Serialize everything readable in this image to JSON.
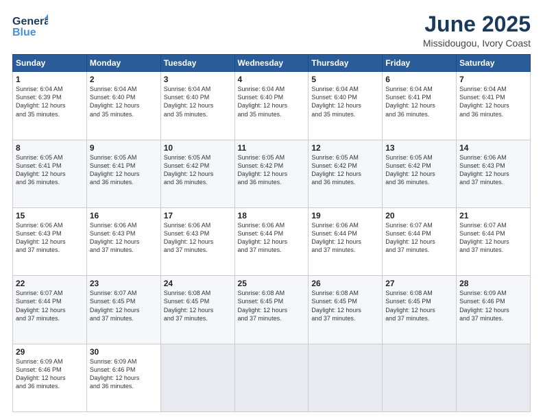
{
  "header": {
    "logo_line1": "General",
    "logo_line2": "Blue",
    "title": "June 2025",
    "subtitle": "Missidougou, Ivory Coast"
  },
  "calendar": {
    "days_of_week": [
      "Sunday",
      "Monday",
      "Tuesday",
      "Wednesday",
      "Thursday",
      "Friday",
      "Saturday"
    ],
    "weeks": [
      [
        {
          "day": "1",
          "info": "Sunrise: 6:04 AM\nSunset: 6:39 PM\nDaylight: 12 hours\nand 35 minutes."
        },
        {
          "day": "2",
          "info": "Sunrise: 6:04 AM\nSunset: 6:40 PM\nDaylight: 12 hours\nand 35 minutes."
        },
        {
          "day": "3",
          "info": "Sunrise: 6:04 AM\nSunset: 6:40 PM\nDaylight: 12 hours\nand 35 minutes."
        },
        {
          "day": "4",
          "info": "Sunrise: 6:04 AM\nSunset: 6:40 PM\nDaylight: 12 hours\nand 35 minutes."
        },
        {
          "day": "5",
          "info": "Sunrise: 6:04 AM\nSunset: 6:40 PM\nDaylight: 12 hours\nand 35 minutes."
        },
        {
          "day": "6",
          "info": "Sunrise: 6:04 AM\nSunset: 6:41 PM\nDaylight: 12 hours\nand 36 minutes."
        },
        {
          "day": "7",
          "info": "Sunrise: 6:04 AM\nSunset: 6:41 PM\nDaylight: 12 hours\nand 36 minutes."
        }
      ],
      [
        {
          "day": "8",
          "info": "Sunrise: 6:05 AM\nSunset: 6:41 PM\nDaylight: 12 hours\nand 36 minutes."
        },
        {
          "day": "9",
          "info": "Sunrise: 6:05 AM\nSunset: 6:41 PM\nDaylight: 12 hours\nand 36 minutes."
        },
        {
          "day": "10",
          "info": "Sunrise: 6:05 AM\nSunset: 6:42 PM\nDaylight: 12 hours\nand 36 minutes."
        },
        {
          "day": "11",
          "info": "Sunrise: 6:05 AM\nSunset: 6:42 PM\nDaylight: 12 hours\nand 36 minutes."
        },
        {
          "day": "12",
          "info": "Sunrise: 6:05 AM\nSunset: 6:42 PM\nDaylight: 12 hours\nand 36 minutes."
        },
        {
          "day": "13",
          "info": "Sunrise: 6:05 AM\nSunset: 6:42 PM\nDaylight: 12 hours\nand 36 minutes."
        },
        {
          "day": "14",
          "info": "Sunrise: 6:06 AM\nSunset: 6:43 PM\nDaylight: 12 hours\nand 37 minutes."
        }
      ],
      [
        {
          "day": "15",
          "info": "Sunrise: 6:06 AM\nSunset: 6:43 PM\nDaylight: 12 hours\nand 37 minutes."
        },
        {
          "day": "16",
          "info": "Sunrise: 6:06 AM\nSunset: 6:43 PM\nDaylight: 12 hours\nand 37 minutes."
        },
        {
          "day": "17",
          "info": "Sunrise: 6:06 AM\nSunset: 6:43 PM\nDaylight: 12 hours\nand 37 minutes."
        },
        {
          "day": "18",
          "info": "Sunrise: 6:06 AM\nSunset: 6:44 PM\nDaylight: 12 hours\nand 37 minutes."
        },
        {
          "day": "19",
          "info": "Sunrise: 6:06 AM\nSunset: 6:44 PM\nDaylight: 12 hours\nand 37 minutes."
        },
        {
          "day": "20",
          "info": "Sunrise: 6:07 AM\nSunset: 6:44 PM\nDaylight: 12 hours\nand 37 minutes."
        },
        {
          "day": "21",
          "info": "Sunrise: 6:07 AM\nSunset: 6:44 PM\nDaylight: 12 hours\nand 37 minutes."
        }
      ],
      [
        {
          "day": "22",
          "info": "Sunrise: 6:07 AM\nSunset: 6:44 PM\nDaylight: 12 hours\nand 37 minutes."
        },
        {
          "day": "23",
          "info": "Sunrise: 6:07 AM\nSunset: 6:45 PM\nDaylight: 12 hours\nand 37 minutes."
        },
        {
          "day": "24",
          "info": "Sunrise: 6:08 AM\nSunset: 6:45 PM\nDaylight: 12 hours\nand 37 minutes."
        },
        {
          "day": "25",
          "info": "Sunrise: 6:08 AM\nSunset: 6:45 PM\nDaylight: 12 hours\nand 37 minutes."
        },
        {
          "day": "26",
          "info": "Sunrise: 6:08 AM\nSunset: 6:45 PM\nDaylight: 12 hours\nand 37 minutes."
        },
        {
          "day": "27",
          "info": "Sunrise: 6:08 AM\nSunset: 6:45 PM\nDaylight: 12 hours\nand 37 minutes."
        },
        {
          "day": "28",
          "info": "Sunrise: 6:09 AM\nSunset: 6:46 PM\nDaylight: 12 hours\nand 37 minutes."
        }
      ],
      [
        {
          "day": "29",
          "info": "Sunrise: 6:09 AM\nSunset: 6:46 PM\nDaylight: 12 hours\nand 36 minutes."
        },
        {
          "day": "30",
          "info": "Sunrise: 6:09 AM\nSunset: 6:46 PM\nDaylight: 12 hours\nand 36 minutes."
        },
        {
          "day": "",
          "info": ""
        },
        {
          "day": "",
          "info": ""
        },
        {
          "day": "",
          "info": ""
        },
        {
          "day": "",
          "info": ""
        },
        {
          "day": "",
          "info": ""
        }
      ]
    ]
  }
}
